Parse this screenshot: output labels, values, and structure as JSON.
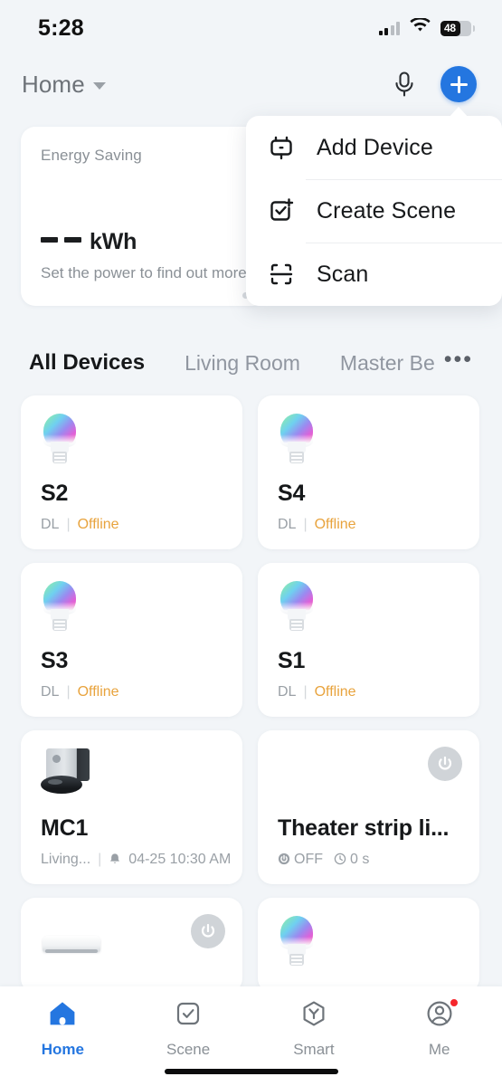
{
  "status_bar": {
    "time": "5:28",
    "battery_percent": "48",
    "signal_icon": "cellular-signal-icon",
    "wifi_icon": "wifi-icon",
    "battery_icon": "battery-icon"
  },
  "top_bar": {
    "home_label": "Home",
    "caret_icon": "chevron-down-icon",
    "mic_icon": "microphone-icon",
    "add_icon": "plus-icon"
  },
  "energy_card": {
    "title": "Energy Saving",
    "value": "––",
    "unit": "kWh",
    "subtitle": "Set the power to find out more"
  },
  "menu": {
    "items": [
      {
        "label": "Add Device",
        "icon": "device-icon"
      },
      {
        "label": "Create Scene",
        "icon": "add-scene-icon"
      },
      {
        "label": "Scan",
        "icon": "scan-icon"
      }
    ]
  },
  "tabs": {
    "items": [
      {
        "label": "All Devices",
        "active": true
      },
      {
        "label": "Living Room",
        "active": false
      },
      {
        "label": "Master Be",
        "active": false
      }
    ],
    "more_label": "•••"
  },
  "devices": [
    {
      "name": "S2",
      "room": "DL",
      "separator": "|",
      "status": "Offline",
      "status_type": "offline",
      "icon": "rgb-bulb-icon",
      "power_button": false
    },
    {
      "name": "S4",
      "room": "DL",
      "separator": "|",
      "status": "Offline",
      "status_type": "offline",
      "icon": "rgb-bulb-icon",
      "power_button": false
    },
    {
      "name": "S3",
      "room": "DL",
      "separator": "|",
      "status": "Offline",
      "status_type": "offline",
      "icon": "rgb-bulb-icon",
      "power_button": false
    },
    {
      "name": "S1",
      "room": "DL",
      "separator": "|",
      "status": "Offline",
      "status_type": "offline",
      "icon": "rgb-bulb-icon",
      "power_button": false
    },
    {
      "name": "MC1",
      "room": "Living...",
      "separator": "|",
      "status": "04-25 10:30 AM",
      "status_type": "schedule",
      "icon": "robot-vacuum-icon",
      "power_button": false
    },
    {
      "name": "Theater strip li...",
      "room": "",
      "separator": "",
      "status": "OFF",
      "status_type": "power",
      "timer": "0 s",
      "icon": "light-strip-icon",
      "power_button": true
    }
  ],
  "partial_devices": [
    {
      "icon": "air-conditioner-icon",
      "power_button": true
    },
    {
      "icon": "rgb-bulb-icon",
      "power_button": false
    }
  ],
  "bottom_nav": {
    "items": [
      {
        "label": "Home",
        "icon": "home-icon",
        "active": true,
        "badge": false
      },
      {
        "label": "Scene",
        "icon": "scene-icon",
        "active": false,
        "badge": false
      },
      {
        "label": "Smart",
        "icon": "smart-icon",
        "active": false,
        "badge": false
      },
      {
        "label": "Me",
        "icon": "profile-icon",
        "active": false,
        "badge": true
      }
    ]
  },
  "colors": {
    "accent": "#2476E0",
    "offline": "#E8A33D",
    "background": "#F2F5F8",
    "card": "#FFFFFF",
    "badge": "#F5262C"
  }
}
